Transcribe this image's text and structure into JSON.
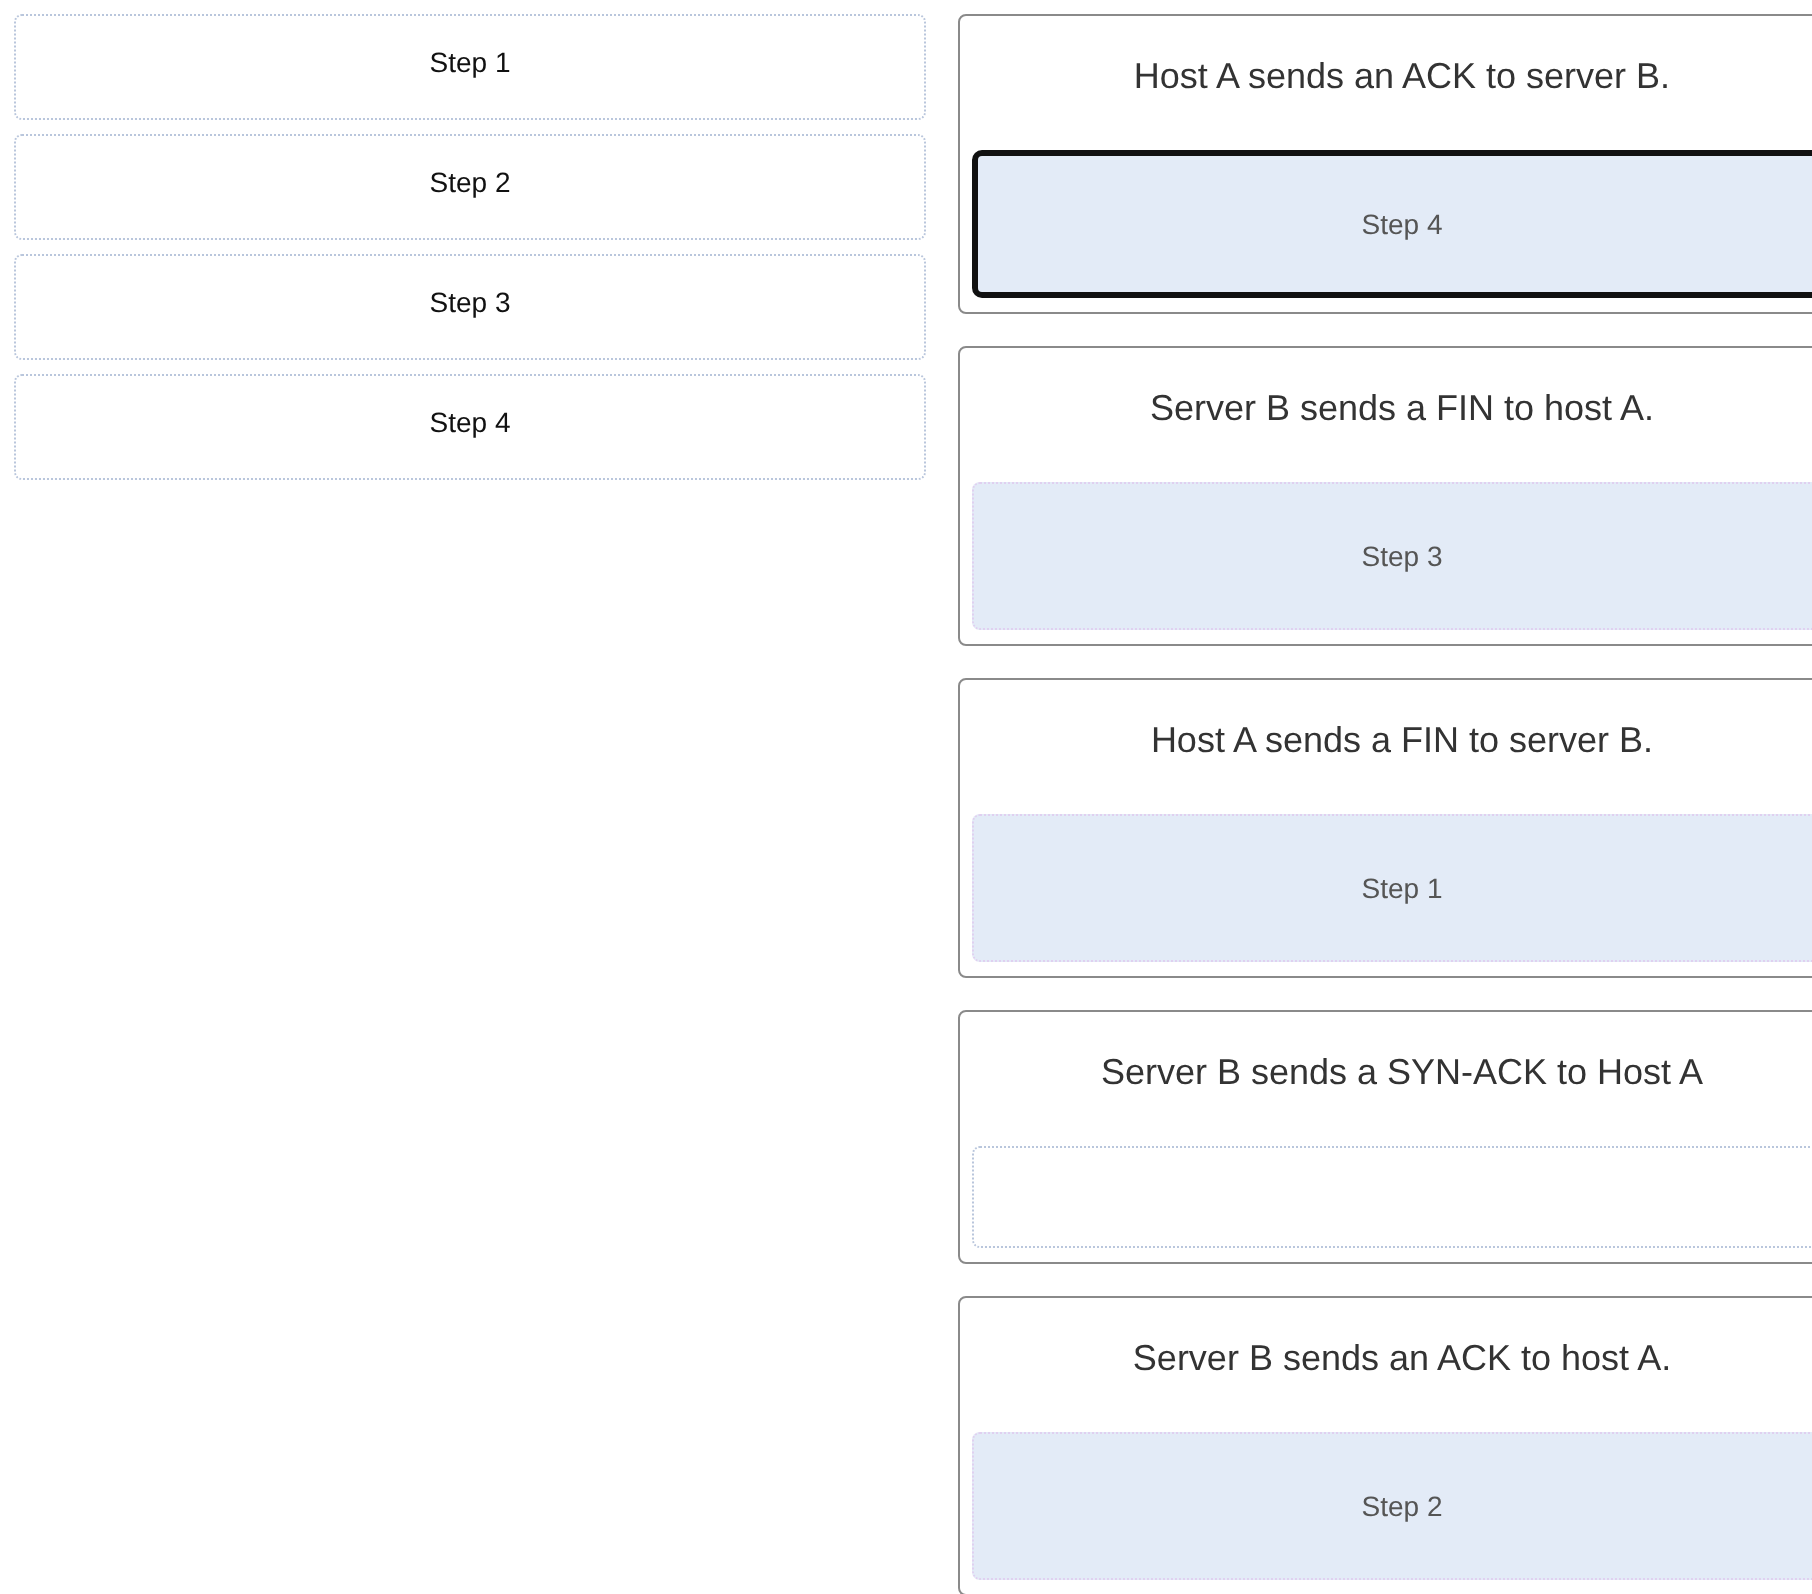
{
  "choices": [
    {
      "label": "Step 1"
    },
    {
      "label": "Step 2"
    },
    {
      "label": "Step 3"
    },
    {
      "label": "Step 4"
    }
  ],
  "targets": [
    {
      "prompt": "Host A sends an ACK to server B.",
      "answer": "Step 4",
      "selected": true
    },
    {
      "prompt": "Server B sends a FIN to host A.",
      "answer": "Step 3",
      "selected": false
    },
    {
      "prompt": "Host A sends a FIN to server B.",
      "answer": "Step 1",
      "selected": false
    },
    {
      "prompt": "Server B sends a SYN-ACK to Host A",
      "selected": false
    },
    {
      "prompt": "Server B sends an ACK to host A.",
      "answer": "Step 2",
      "selected": false
    }
  ]
}
